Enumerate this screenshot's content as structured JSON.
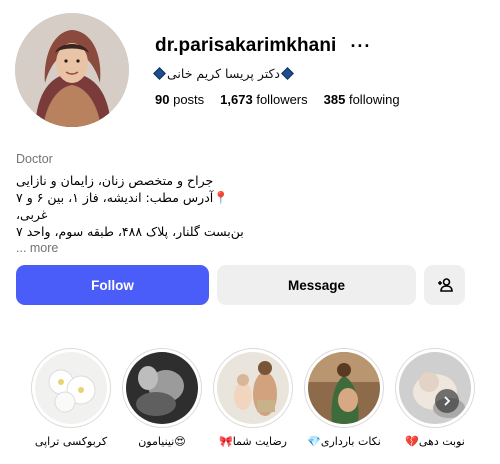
{
  "profile": {
    "username": "dr.parisakarimkhani",
    "display_name": "دکتر پریسا کریم خانی",
    "stats": {
      "posts_count": "90",
      "posts_label": "posts",
      "followers_count": "1,673",
      "followers_label": "followers",
      "following_count": "385",
      "following_label": "following"
    }
  },
  "bio": {
    "category": "Doctor",
    "lines": [
      "جراح و متخصص زنان، زایمان و نازایی",
      "📍آدرس مطب: اندیشه، فاز ۱، بین ۶ و ۷ غربی،",
      "بن‌بست گلنار، پلاک ۴۸۸، طبقه سوم، واحد ۷"
    ],
    "more_label": "... more"
  },
  "actions": {
    "follow_label": "Follow",
    "message_label": "Message"
  },
  "highlights": [
    {
      "label": "کربوکسی تراپی"
    },
    {
      "label": "😍نینیامون"
    },
    {
      "label": "رضایت شما🎀"
    },
    {
      "label": "نکات بارداری💎"
    },
    {
      "label": "نوبت دهی💔"
    }
  ],
  "colors": {
    "follow_button": "#4a5df9",
    "secondary_button": "#efefef",
    "muted_text": "#737373"
  },
  "icons": {
    "more": "more-options-icon",
    "add_user": "add-user-icon",
    "next": "chevron-right-icon"
  }
}
